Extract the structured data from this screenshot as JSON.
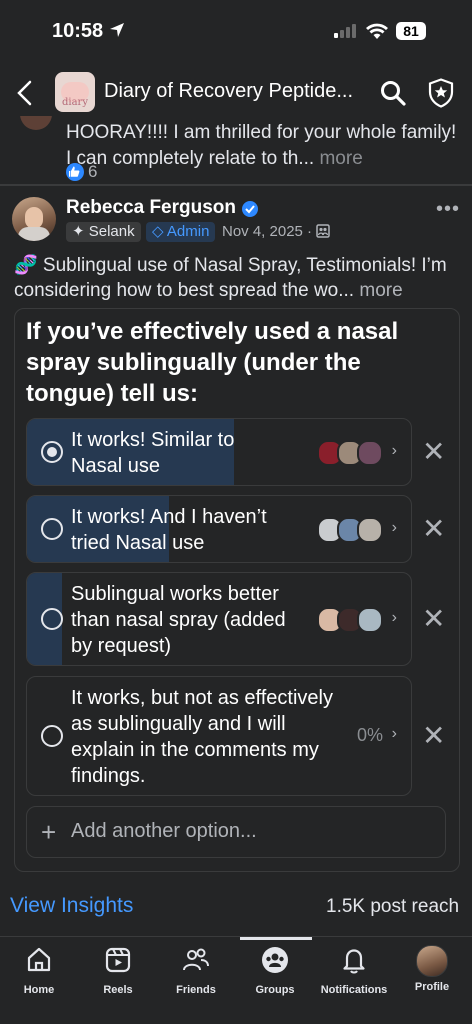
{
  "status": {
    "time": "10:58",
    "battery": "81"
  },
  "header": {
    "title": "Diary of Recovery Peptide...",
    "group_thumb_text": "diary"
  },
  "previous_comment": {
    "text": "HOORAY!!!! I am thrilled for your whole family!  I can completely relate to th...",
    "more": "more",
    "like_count": "6"
  },
  "post": {
    "author": "Rebecca Ferguson",
    "tags": {
      "topic": "Selank",
      "role": "Admin"
    },
    "date": "Nov 4, 2025 ·",
    "text": "🧬 Sublingual use of Nasal Spray, Testimonials! I’m considering how to best spread the wo...",
    "more": "more"
  },
  "poll": {
    "question": "If you’ve effectively used a nasal spray sublingually (under the tongue) tell us:",
    "options": [
      {
        "label": "It works! Similar to Nasal use",
        "selected": true,
        "fill_fraction": 0.54
      },
      {
        "label": "It works! And I haven’t tried Nasal use",
        "selected": false,
        "fill_fraction": 0.37
      },
      {
        "label": "Sublingual works better than nasal spray (added by request)",
        "selected": false,
        "fill_fraction": 0.09
      },
      {
        "label": "It works, but not as effectively as sublingually and I will explain in the comments my findings.",
        "selected": false,
        "fill_fraction": 0,
        "percent": "0%"
      }
    ],
    "add_option": "Add another option..."
  },
  "insights": {
    "link": "View Insights",
    "reach": "1.5K post reach"
  },
  "nav": {
    "home": "Home",
    "reels": "Reels",
    "friends": "Friends",
    "groups": "Groups",
    "notifications": "Notifications",
    "profile": "Profile"
  },
  "colors": {
    "accent": "#2d88ff",
    "poll_fill": "#263951",
    "background": "#242526"
  }
}
